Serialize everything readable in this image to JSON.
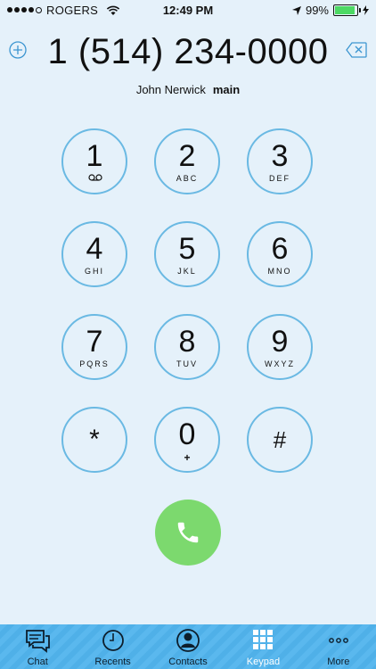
{
  "status": {
    "carrier": "ROGERS",
    "time": "12:49 PM",
    "battery": "99%",
    "battery_level": 0.99
  },
  "dialer": {
    "number": "1 (514) 234-0000",
    "contact_name": "John Nerwick",
    "contact_label": "main"
  },
  "keys": [
    {
      "digit": "1",
      "letters": ""
    },
    {
      "digit": "2",
      "letters": "ABC"
    },
    {
      "digit": "3",
      "letters": "DEF"
    },
    {
      "digit": "4",
      "letters": "GHI"
    },
    {
      "digit": "5",
      "letters": "JKL"
    },
    {
      "digit": "6",
      "letters": "MNO"
    },
    {
      "digit": "7",
      "letters": "PQRS"
    },
    {
      "digit": "8",
      "letters": "TUV"
    },
    {
      "digit": "9",
      "letters": "WXYZ"
    },
    {
      "digit": "*",
      "letters": ""
    },
    {
      "digit": "0",
      "letters": "+"
    },
    {
      "digit": "#",
      "letters": ""
    }
  ],
  "tabs": [
    {
      "label": "Chat",
      "icon": "chat-icon"
    },
    {
      "label": "Recents",
      "icon": "clock-icon"
    },
    {
      "label": "Contacts",
      "icon": "contact-icon"
    },
    {
      "label": "Keypad",
      "icon": "keypad-icon"
    },
    {
      "label": "More",
      "icon": "more-icon"
    }
  ],
  "colors": {
    "background": "#e5f1fa",
    "key_border": "#6ab9e3",
    "call_button": "#7cd96e",
    "tab_bar": "#5ab8ee",
    "active_tab": "#ffffff",
    "battery": "#4cd964"
  }
}
